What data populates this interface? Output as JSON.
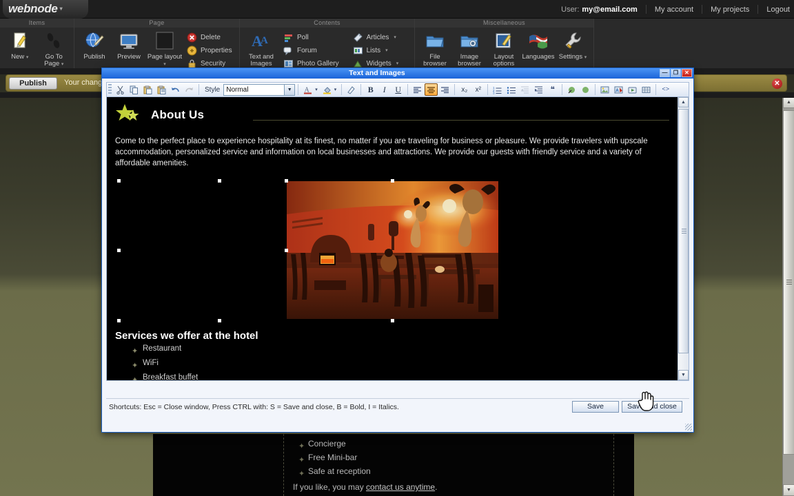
{
  "admin": {
    "logo": "webnode",
    "logo_caret": "▾",
    "user": {
      "label": "User:",
      "email": "my@email.com",
      "my_account": "My account",
      "my_projects": "My projects",
      "logout": "Logout"
    },
    "ribbon": {
      "groups": [
        {
          "title": "Items",
          "big": [
            {
              "label": "New",
              "dd": "▾",
              "icon": "new-page-icon"
            },
            {
              "label": "Go To Page",
              "dd": "▾",
              "icon": "footsteps-icon"
            }
          ],
          "small": []
        },
        {
          "title": "Page",
          "big": [
            {
              "label": "Publish",
              "dd": "",
              "icon": "publish-globe-icon"
            },
            {
              "label": "Preview",
              "dd": "",
              "icon": "monitor-icon"
            },
            {
              "label": "Page layout",
              "dd": "▾",
              "icon": "page-layout-icon"
            }
          ],
          "small": [
            {
              "label": "Delete",
              "dd": "",
              "icon": "delete-icon"
            },
            {
              "label": "Properties",
              "dd": "",
              "icon": "properties-icon"
            },
            {
              "label": "Security",
              "dd": "",
              "icon": "security-lock-icon"
            }
          ]
        },
        {
          "title": "Contents",
          "big": [
            {
              "label": "Text and Images",
              "dd": "",
              "icon": "text-and-images-icon"
            }
          ],
          "small": [
            {
              "label": "Poll",
              "dd": "",
              "icon": "poll-icon"
            },
            {
              "label": "Forum",
              "dd": "",
              "icon": "forum-icon"
            },
            {
              "label": "Photo Gallery",
              "dd": "",
              "icon": "photo-gallery-icon"
            }
          ],
          "small2": [
            {
              "label": "Articles",
              "dd": "▾",
              "icon": "articles-icon"
            },
            {
              "label": "Lists",
              "dd": "▾",
              "icon": "lists-icon"
            },
            {
              "label": "Widgets",
              "dd": "▾",
              "icon": "widgets-icon"
            }
          ]
        },
        {
          "title": "Miscellaneous",
          "big": [
            {
              "label": "File browser",
              "dd": "",
              "icon": "file-browser-icon"
            },
            {
              "label": "Image browser",
              "dd": "",
              "icon": "image-browser-icon"
            },
            {
              "label": "Layout options",
              "dd": "",
              "icon": "layout-options-icon"
            },
            {
              "label": "Languages",
              "dd": "",
              "icon": "languages-flag-icon"
            },
            {
              "label": "Settings",
              "dd": "▾",
              "icon": "settings-wrench-icon"
            }
          ],
          "small": []
        }
      ]
    },
    "publish_bar": {
      "button": "Publish",
      "message": "Your changes",
      "close": "✕"
    }
  },
  "dialog": {
    "title": "Text and Images",
    "window_buttons": {
      "minimize": "—",
      "maximize": "❐",
      "close": "✕"
    },
    "toolbar": {
      "style_label": "Style",
      "style_value": "Normal",
      "dropdown_arrow": "▼",
      "buttons": [
        {
          "name": "cut-icon",
          "glyph": "✂"
        },
        {
          "name": "copy-icon",
          "glyph": "❐"
        },
        {
          "name": "paste-icon",
          "glyph": "📋"
        },
        {
          "name": "paste-text-icon",
          "glyph": "📋"
        },
        {
          "name": "undo-icon",
          "glyph": "↶"
        },
        {
          "name": "redo-icon",
          "glyph": "↷"
        },
        {
          "name": "font-color-icon",
          "glyph": "A"
        },
        {
          "name": "background-color-icon",
          "glyph": "🖌"
        },
        {
          "name": "remove-format-icon",
          "glyph": "✎"
        },
        {
          "name": "bold-icon",
          "glyph": "B"
        },
        {
          "name": "italic-icon",
          "glyph": "I"
        },
        {
          "name": "underline-icon",
          "glyph": "U"
        },
        {
          "name": "align-left-icon",
          "glyph": "≡"
        },
        {
          "name": "align-center-icon",
          "glyph": "≡"
        },
        {
          "name": "align-right-icon",
          "glyph": "≡"
        },
        {
          "name": "subscript-icon",
          "glyph": "x₂"
        },
        {
          "name": "superscript-icon",
          "glyph": "x²"
        },
        {
          "name": "numbered-list-icon",
          "glyph": "≔"
        },
        {
          "name": "bulleted-list-icon",
          "glyph": "≔"
        },
        {
          "name": "outdent-icon",
          "glyph": "⇤"
        },
        {
          "name": "indent-icon",
          "glyph": "⇥"
        },
        {
          "name": "blockquote-icon",
          "glyph": "❝"
        },
        {
          "name": "unlink-icon",
          "glyph": "🔗"
        },
        {
          "name": "link-icon",
          "glyph": "🔗"
        },
        {
          "name": "insert-image-icon",
          "glyph": "🖼"
        },
        {
          "name": "insert-flash-icon",
          "glyph": "🅰"
        },
        {
          "name": "insert-media-icon",
          "glyph": "🎞"
        },
        {
          "name": "insert-table-icon",
          "glyph": "▦"
        },
        {
          "name": "source-code-icon",
          "glyph": "<>"
        }
      ],
      "active_button": "align-center-icon"
    },
    "content": {
      "heading": "About Us",
      "paragraph": "Come to the perfect place to experience hospitality at its finest, no matter if you are traveling for business or pleasure. We provide travelers with upscale accommodation, personalized service and information on local businesses and attractions. We provide our guests with friendly service and a variety of affordable amenities.",
      "image_alt": "restaurant-interior-photo",
      "services_heading": "Services we offer at the hotel",
      "services": [
        "Restaurant",
        "WiFi",
        "Breakfast buffet"
      ],
      "bullet": "✦"
    },
    "footer": {
      "shortcuts": "Shortcuts: Esc = Close window, Press CTRL with: S = Save and close, B = Bold, I = Italics.",
      "save": "Save",
      "save_and_close": "Save and close"
    },
    "scrollbar": {
      "up": "▲",
      "down": "▼"
    }
  },
  "site": {
    "services": [
      "Concierge",
      "Free Mini-bar",
      "Safe at reception"
    ],
    "bullet": "✦",
    "contact_prefix": "If you like, you may ",
    "contact_link": "contact us anytime",
    "contact_suffix": "."
  },
  "browser_scrollbar": {
    "up": "▲",
    "down": "▼"
  },
  "colors": {
    "accent_blue": "#1a64d8",
    "ribbon_bg": "#2a2a2a",
    "publish_gold": "#8a7b3b",
    "site_green": "#4a4b36"
  }
}
